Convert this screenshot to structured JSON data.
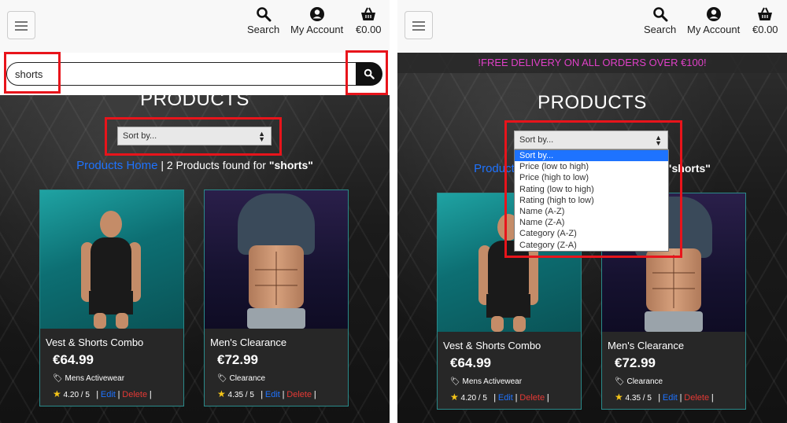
{
  "header": {
    "search_label": "Search",
    "account_label": "My Account",
    "cart_total": "€0.00"
  },
  "search": {
    "value": "shorts"
  },
  "banner": {
    "text": "!FREE DELIVERY ON ALL ORDERS OVER €100!"
  },
  "page": {
    "title": "PRODUCTS",
    "sort_placeholder": "Sort by...",
    "products_home_link": "Products Home",
    "separator": "|",
    "results_text": "2 Products found for",
    "results_query": "\"shorts\""
  },
  "sort_options": [
    "Sort by...",
    "Price (low to high)",
    "Price (high to low)",
    "Rating (low to high)",
    "Rating (high to low)",
    "Name (A-Z)",
    "Name (Z-A)",
    "Category (A-Z)",
    "Category (Z-A)"
  ],
  "products": [
    {
      "name": "Vest & Shorts Combo",
      "price": "€64.99",
      "category": "Mens Activewear",
      "rating": "4.20 / 5",
      "edit_label": "Edit",
      "delete_label": "Delete"
    },
    {
      "name": "Men's Clearance",
      "price": "€72.99",
      "category": "Clearance",
      "rating": "4.35 / 5",
      "edit_label": "Edit",
      "delete_label": "Delete"
    }
  ],
  "colors": {
    "highlight": "#e8141b",
    "link": "#1e73ff",
    "delete": "#e53935",
    "banner_text": "#e040c8",
    "card_border": "#2a8a8a"
  },
  "icons": [
    "hamburger-icon",
    "search-icon",
    "account-icon",
    "basket-icon",
    "tag-icon",
    "star-icon"
  ]
}
